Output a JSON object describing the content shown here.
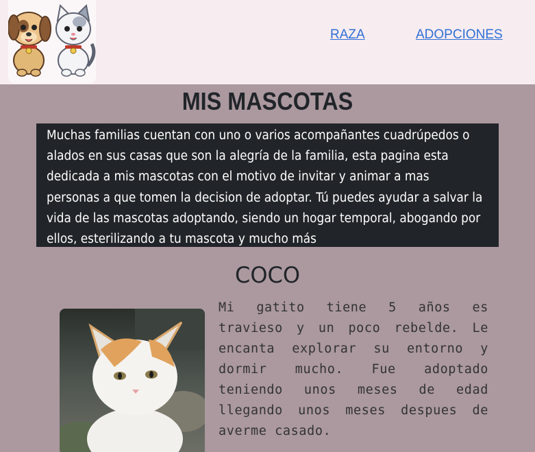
{
  "header": {
    "logo_icon": "cartoon-dog-and-cat-logo",
    "nav": [
      {
        "label": "RAZA"
      },
      {
        "label": "ADOPCIONES"
      }
    ]
  },
  "main": {
    "title": "MIS MASCOTAS",
    "intro": "Muchas familias cuentan con uno o varios acompañantes cuadrúpedos o alados en sus casas que son la alegría de la familia, esta pagina esta dedicada a mis mascotas con el motivo de invitar y animar a mas personas a que tomen la decision de adoptar. Tú puedes ayudar a salvar la vida de las mascotas adoptando, siendo un hogar temporal, abogando por ellos, esterilizando a tu mascota y mucho más"
  },
  "pet": {
    "name": "COCO",
    "photo_icon": "white-orange-cat-photo",
    "description": "Mi gatito tiene 5 años es travieso y un poco rebelde. Le encanta explorar su entorno y dormir mucho. Fue adoptado teniendo unos meses de edad llegando unos meses despues de averme casado."
  },
  "colors": {
    "page_bg": "#ab999f",
    "header_bg": "#f7ecef",
    "intro_bg": "#212529",
    "link": "#2f6fd6"
  }
}
